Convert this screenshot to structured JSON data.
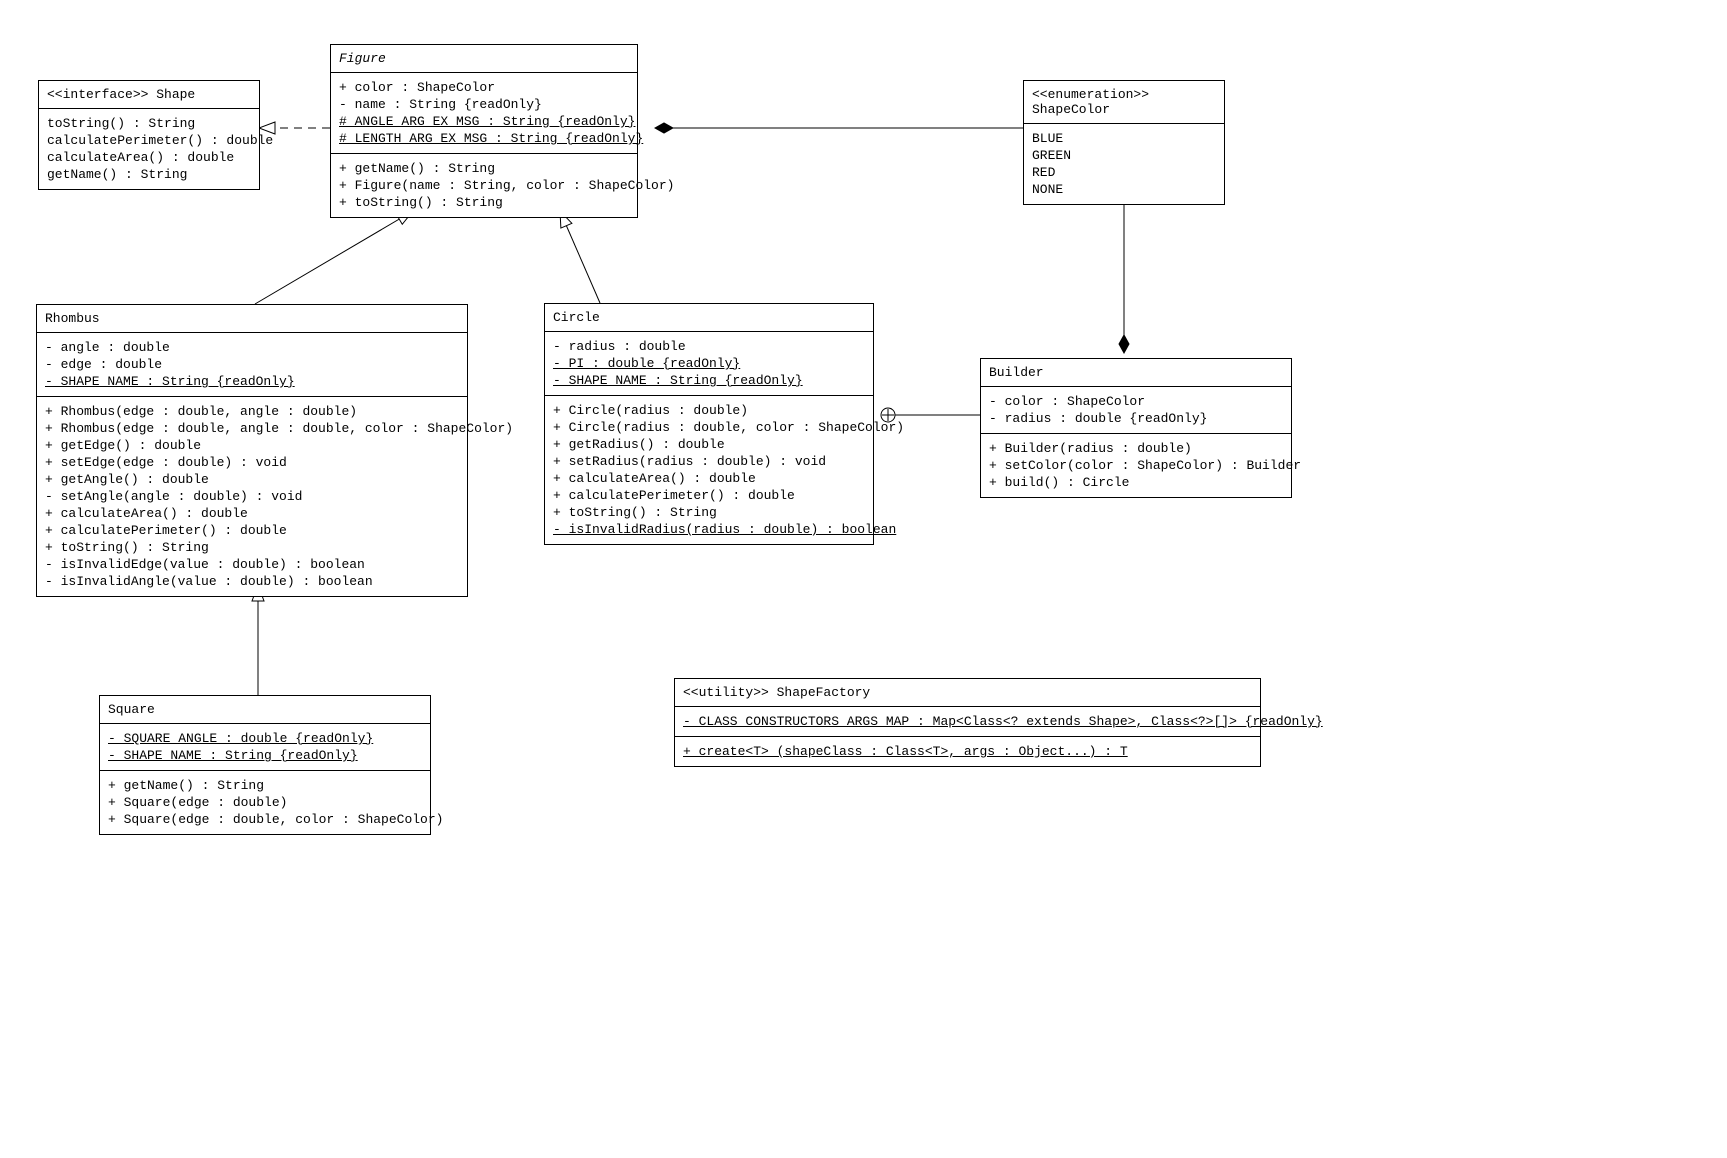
{
  "shape": {
    "name": "<<interface>> Shape",
    "ops": [
      "toString() : String",
      "calculatePerimeter() : double",
      "calculateArea() : double",
      "getName() : String"
    ]
  },
  "figure": {
    "name": "Figure",
    "attrs": [
      {
        "t": "+ color : ShapeColor",
        "u": false
      },
      {
        "t": "- name : String {readOnly}",
        "u": false
      },
      {
        "t": "# ANGLE_ARG_EX_MSG : String {readOnly}",
        "u": true
      },
      {
        "t": "# LENGTH_ARG_EX_MSG : String {readOnly}",
        "u": true
      }
    ],
    "ops": [
      "+ getName() : String",
      "+ Figure(name : String, color : ShapeColor)",
      "+ toString() : String"
    ]
  },
  "shapeColor": {
    "name": "<<enumeration>> ShapeColor",
    "values": [
      "BLUE",
      "GREEN",
      "RED",
      "NONE"
    ]
  },
  "rhombus": {
    "name": "Rhombus",
    "attrs": [
      {
        "t": "- angle : double",
        "u": false
      },
      {
        "t": "- edge : double",
        "u": false
      },
      {
        "t": "- SHAPE_NAME : String {readOnly}",
        "u": true
      }
    ],
    "ops": [
      "+ Rhombus(edge : double, angle : double)",
      "+ Rhombus(edge : double, angle : double, color : ShapeColor)",
      "+ getEdge() : double",
      "+ setEdge(edge : double) : void",
      "+ getAngle() : double",
      "- setAngle(angle : double) : void",
      "+ calculateArea() : double",
      "+ calculatePerimeter() : double",
      "+ toString() : String",
      "- isInvalidEdge(value : double) : boolean",
      "- isInvalidAngle(value : double) : boolean"
    ]
  },
  "circle": {
    "name": "Circle",
    "attrs": [
      {
        "t": "- radius : double",
        "u": false
      },
      {
        "t": "- PI : double {readOnly}",
        "u": true
      },
      {
        "t": "- SHAPE_NAME : String {readOnly}",
        "u": true
      }
    ],
    "ops": [
      {
        "t": "+ Circle(radius : double)",
        "u": false
      },
      {
        "t": "+ Circle(radius : double, color : ShapeColor)",
        "u": false
      },
      {
        "t": "+ getRadius() : double",
        "u": false
      },
      {
        "t": "+ setRadius(radius : double) : void",
        "u": false
      },
      {
        "t": "+ calculateArea() : double",
        "u": false
      },
      {
        "t": "+ calculatePerimeter() : double",
        "u": false
      },
      {
        "t": "+ toString() : String",
        "u": false
      },
      {
        "t": "- isInvalidRadius(radius : double) : boolean",
        "u": true
      }
    ]
  },
  "builder": {
    "name": "Builder",
    "attrs": [
      "- color : ShapeColor",
      "- radius : double {readOnly}"
    ],
    "ops": [
      "+ Builder(radius : double)",
      "+ setColor(color : ShapeColor) : Builder",
      "+ build() : Circle"
    ]
  },
  "square": {
    "name": "Square",
    "attrs": [
      {
        "t": "- SQUARE_ANGLE : double {readOnly}",
        "u": true
      },
      {
        "t": "- SHAPE_NAME : String {readOnly}",
        "u": true
      }
    ],
    "ops": [
      "+ getName() : String",
      "+ Square(edge : double)",
      "+ Square(edge : double, color : ShapeColor)"
    ]
  },
  "shapeFactory": {
    "name": "<<utility>> ShapeFactory",
    "attrs": [
      {
        "t": "- CLASS_CONSTRUCTORS_ARGS_MAP : Map<Class<? extends Shape>, Class<?>[]> {readOnly}",
        "u": true
      }
    ],
    "ops": [
      {
        "t": "+ create<T> (shapeClass : Class<T>, args : Object...) : T",
        "u": true
      }
    ]
  }
}
